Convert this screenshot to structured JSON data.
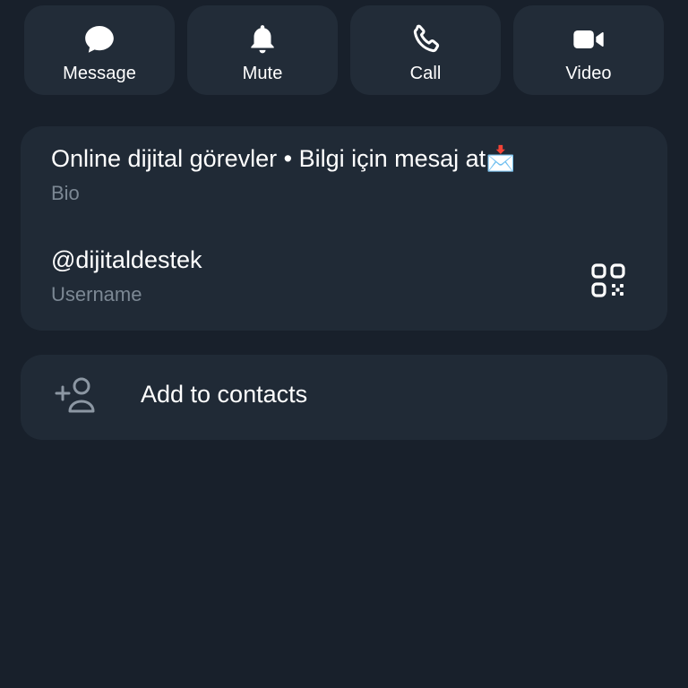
{
  "actions": [
    {
      "label": "Message",
      "icon": "chat-bubble-icon"
    },
    {
      "label": "Mute",
      "icon": "bell-icon"
    },
    {
      "label": "Call",
      "icon": "phone-icon"
    },
    {
      "label": "Video",
      "icon": "video-camera-icon"
    }
  ],
  "info": {
    "bio": {
      "value": "Online dijital görevler • Bilgi için mesaj at📩",
      "label": "Bio"
    },
    "username": {
      "value": "@dijitaldestek",
      "label": "Username",
      "icon": "qr-code-icon"
    }
  },
  "contacts": {
    "label": "Add to contacts",
    "icon": "add-person-icon"
  },
  "colors": {
    "background": "#18202b",
    "card": "#202a36",
    "button": "#222c38",
    "secondary_text": "#7c8894"
  }
}
